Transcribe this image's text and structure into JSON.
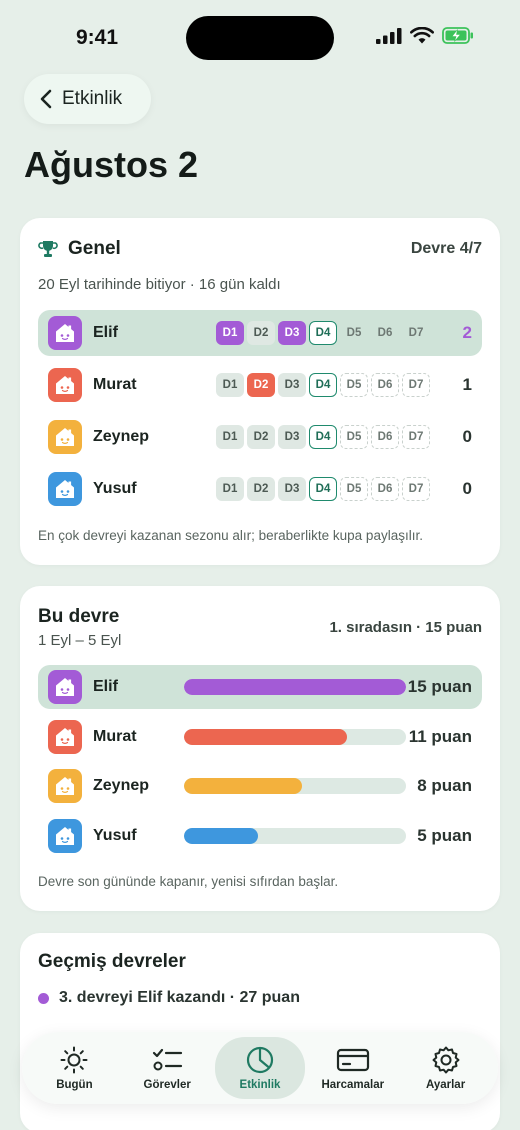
{
  "status": {
    "time": "9:41"
  },
  "header": {
    "back_label": "Etkinlik",
    "title": "Ağustos 2"
  },
  "general": {
    "title": "Genel",
    "period": "Devre 4/7",
    "subtitle": "20 Eyl tarihinde bitiyor · 16 gün kaldı",
    "footer": "En çok devreyi kazanan sezonu alır; beraberlikte kupa paylaşılır.",
    "day_labels": [
      "D1",
      "D2",
      "D3",
      "D4",
      "D5",
      "D6",
      "D7"
    ],
    "players": [
      {
        "name": "Elif",
        "score": "2",
        "color": "#a35bd6",
        "won": [
          1,
          3
        ],
        "active": true
      },
      {
        "name": "Murat",
        "score": "1",
        "color": "#ec6650",
        "won": [
          2
        ],
        "active": false
      },
      {
        "name": "Zeynep",
        "score": "0",
        "color": "#f3b13d",
        "won": [],
        "active": false
      },
      {
        "name": "Yusuf",
        "score": "0",
        "color": "#3e97de",
        "won": [],
        "active": false
      }
    ]
  },
  "period": {
    "title": "Bu devre",
    "date_range": "1 Eyl – 5 Eyl",
    "rank": "1. sıradasın · 15 puan",
    "footer": "Devre son gününde kapanır, yenisi sıfırdan başlar.",
    "max_points": 15,
    "players": [
      {
        "name": "Elif",
        "points": 15,
        "points_label": "15 puan",
        "color": "#a35bd6",
        "active": true
      },
      {
        "name": "Murat",
        "points": 11,
        "points_label": "11 puan",
        "color": "#ec6650",
        "active": false
      },
      {
        "name": "Zeynep",
        "points": 8,
        "points_label": "8 puan",
        "color": "#f3b13d",
        "active": false
      },
      {
        "name": "Yusuf",
        "points": 5,
        "points_label": "5 puan",
        "color": "#3e97de",
        "active": false
      }
    ]
  },
  "history": {
    "title": "Geçmiş devreler",
    "items": [
      {
        "text": "3. devreyi Elif kazandı · 27 puan",
        "color": "#a35bd6"
      }
    ]
  },
  "tabs": [
    {
      "label": "Bugün",
      "icon": "sun-icon",
      "active": false
    },
    {
      "label": "Görevler",
      "icon": "tasks-icon",
      "active": false
    },
    {
      "label": "Etkinlik",
      "icon": "pie-chart-icon",
      "active": true
    },
    {
      "label": "Harcamalar",
      "icon": "card-icon",
      "active": false
    },
    {
      "label": "Ayarlar",
      "icon": "gear-icon",
      "active": false
    }
  ]
}
